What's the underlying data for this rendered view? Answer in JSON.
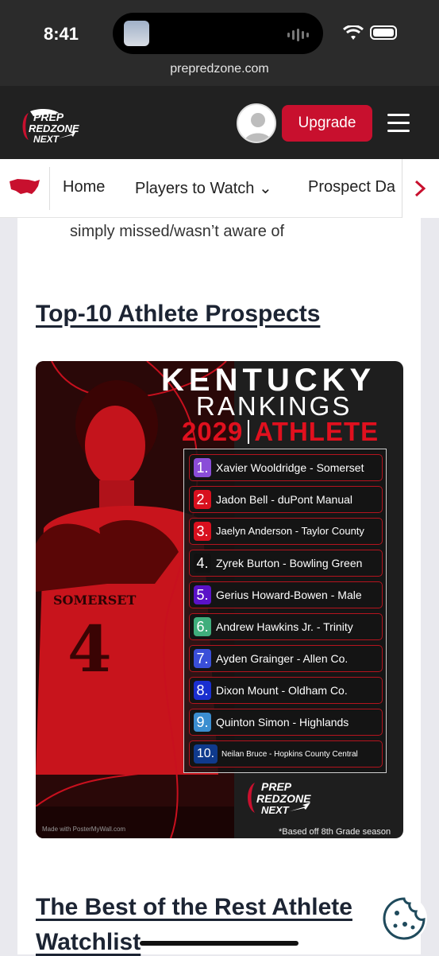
{
  "status": {
    "time": "8:41",
    "url": "prepredzone.com"
  },
  "header": {
    "logo": {
      "line1": "PREP",
      "line2": "REDZONE",
      "line3": "NEXT"
    },
    "upgrade_label": "Upgrade"
  },
  "nav": {
    "items": [
      {
        "label": "Home"
      },
      {
        "label": "Players to Watch ⌄"
      },
      {
        "label": "Prospect Da"
      }
    ]
  },
  "article": {
    "snippet": "simply missed/wasn’t aware of",
    "heading1": "Top-10 Athlete Prospects",
    "heading2_line1": "The Best of the Rest Athlete",
    "heading2_line2": "Watchlist"
  },
  "graphic": {
    "title1": "KENTUCKY",
    "title2": "RANKINGS",
    "year": "2029",
    "position": "ATHLETE",
    "jersey_name": "SOMERSET",
    "jersey_number": "4",
    "rankings": [
      {
        "num": "1.",
        "name": "Xavier Wooldridge - Somerset",
        "color": "#8a4dd8"
      },
      {
        "num": "2.",
        "name": "Jadon Bell - duPont Manual",
        "color": "#d8101e"
      },
      {
        "num": "3.",
        "name": "Jaelyn Anderson - Taylor County",
        "color": "#d8101e"
      },
      {
        "num": "4.",
        "name": "Zyrek Burton - Bowling Green",
        "color": "#111111"
      },
      {
        "num": "5.",
        "name": "Gerius Howard-Bowen - Male",
        "color": "#5a12c8"
      },
      {
        "num": "6.",
        "name": "Andrew Hawkins Jr. - Trinity",
        "color": "#3fae7c"
      },
      {
        "num": "7.",
        "name": "Ayden Grainger - Allen Co.",
        "color": "#3a4fd8"
      },
      {
        "num": "8.",
        "name": "Dixon Mount - Oldham Co.",
        "color": "#1a2fd0"
      },
      {
        "num": "9.",
        "name": "Quinton Simon - Highlands",
        "color": "#3b8ed0"
      },
      {
        "num": "10.",
        "name": "Neilan Bruce - Hopkins County Central",
        "color": "#0f3a8c"
      }
    ],
    "footnote": "*Based off 8th Grade season",
    "credit": "Made with PosterMyWall.com"
  },
  "colors": {
    "brand_red": "#c8102e",
    "header_bg": "#212121"
  }
}
